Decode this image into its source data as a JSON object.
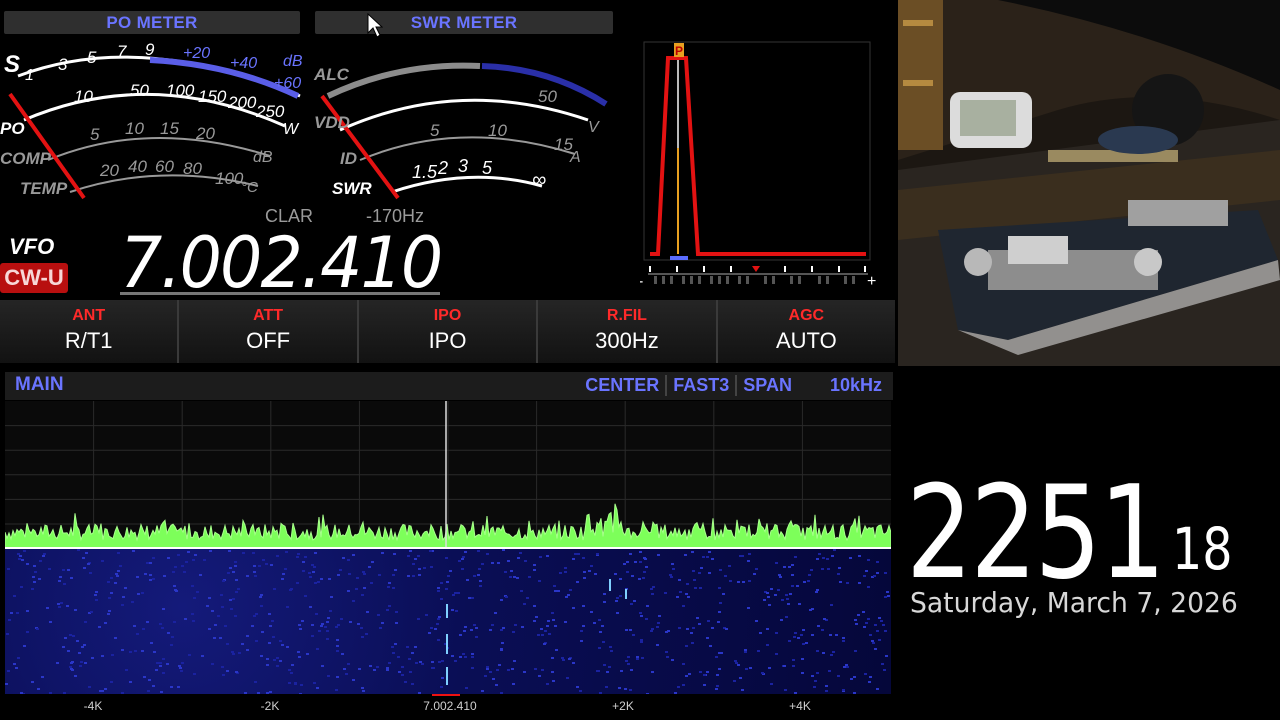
{
  "meters": {
    "po_meter_title": "PO METER",
    "swr_meter_title": "SWR METER",
    "left_scale": {
      "s_label": "S",
      "s_marks": [
        "1",
        "3",
        "5",
        "7",
        "9"
      ],
      "db_marks": [
        "+20",
        "+40",
        "dB",
        "+60"
      ],
      "po_label": "PO",
      "po_marks": [
        "10",
        "50",
        "100",
        "150",
        "200",
        "250",
        "W"
      ],
      "comp_label": "COMP",
      "comp_marks": [
        "5",
        "10",
        "15",
        "20",
        "dB"
      ],
      "temp_label": "TEMP",
      "temp_marks": [
        "20",
        "40",
        "60",
        "80",
        "100",
        "°C"
      ]
    },
    "right_scale": {
      "alc_label": "ALC",
      "vdd_label": "VDD",
      "vdd_marks": [
        "50",
        "V"
      ],
      "id_label": "ID",
      "id_marks": [
        "5",
        "10",
        "15",
        "A"
      ],
      "swr_label": "SWR",
      "swr_marks": [
        "1.5",
        "2",
        "3",
        "5",
        "∞"
      ]
    }
  },
  "clar": {
    "label": "CLAR",
    "value": "-170Hz"
  },
  "vfo": {
    "label": "VFO",
    "mode": "CW-U",
    "frequency": "7.002.410"
  },
  "function_buttons": [
    {
      "title": "ANT",
      "value": "R/T1"
    },
    {
      "title": "ATT",
      "value": "OFF"
    },
    {
      "title": "IPO",
      "value": "IPO"
    },
    {
      "title": "R.FIL",
      "value": "300Hz"
    },
    {
      "title": "AGC",
      "value": "AUTO"
    }
  ],
  "filter_scope": {
    "peak_label": "P",
    "minus": "-",
    "plus": "+"
  },
  "spectrum": {
    "title": "MAIN",
    "mode": "CENTER",
    "speed": "FAST3",
    "span_label": "SPAN",
    "span_value": "10kHz",
    "axis": [
      "-4K",
      "-2K",
      "7.002.410",
      "+2K",
      "+4K"
    ]
  },
  "clock": {
    "hours_minutes": "2251",
    "seconds": "18",
    "date": "Saturday, March 7, 2026"
  },
  "colors": {
    "accent_blue": "#6a74ff",
    "red": "#ff2a2a",
    "spectrum_green": "#7dff5a"
  }
}
